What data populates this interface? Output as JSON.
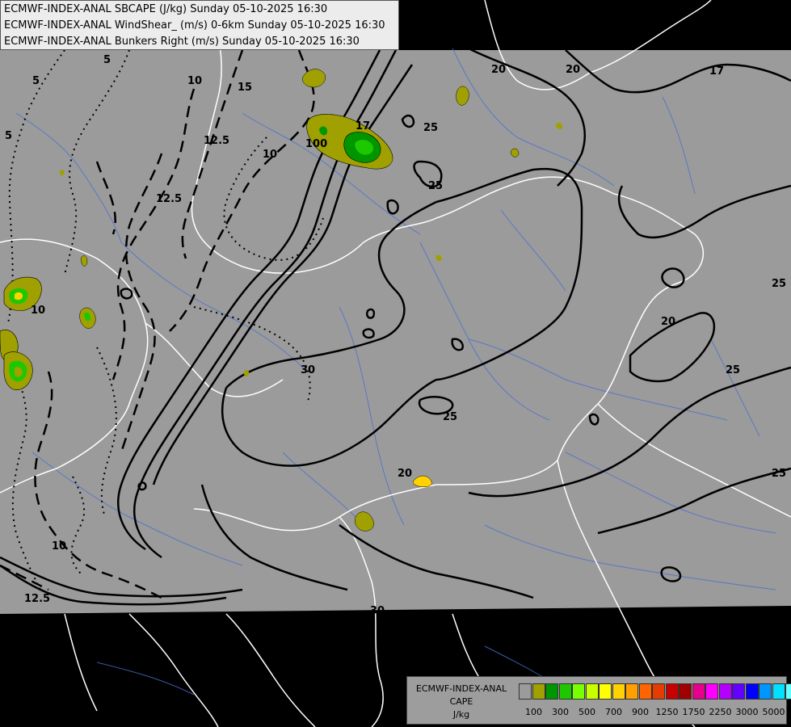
{
  "header": {
    "lines": [
      "ECMWF-INDEX-ANAL SBCAPE (J/kg) Sunday 05-10-2025 16:30",
      "ECMWF-INDEX-ANAL WindShear_ (m/s) 0-6km Sunday 05-10-2025 16:30",
      "ECMWF-INDEX-ANAL Bunkers Right (m/s) Sunday 05-10-2025 16:30"
    ]
  },
  "map": {
    "background_color": "#9b9b9b",
    "outside_color": "#000000",
    "contour_labels": [
      "5",
      "5",
      "5",
      "10",
      "12.5",
      "12.5",
      "15",
      "17",
      "10",
      "100",
      "20",
      "20",
      "17",
      "25",
      "25",
      "30",
      "25",
      "20",
      "25",
      "25",
      "25",
      "20",
      "10",
      "12.5",
      "30",
      "10"
    ],
    "colors": {
      "cape_100": "#a0a000",
      "cape_300": "#009600",
      "cape_500": "#1ec800",
      "cape_700": "#ffd200"
    }
  },
  "legend": {
    "title_lines": [
      "ECMWF-INDEX-ANAL",
      "CAPE",
      "J/kg"
    ],
    "swatches": [
      "#9b9b9b",
      "#a0a000",
      "#009600",
      "#1ec800",
      "#78ff00",
      "#c8ff00",
      "#ffff00",
      "#ffd200",
      "#ffa000",
      "#ff6400",
      "#e63c00",
      "#c80000",
      "#a00000",
      "#e6008c",
      "#ff00ff",
      "#b400ff",
      "#6400ff",
      "#0000ff",
      "#0096ff",
      "#00e1ff",
      "#64ffff",
      "#ffffff"
    ],
    "tick_labels": [
      "100",
      "300",
      "500",
      "700",
      "900",
      "1250",
      "1750",
      "2250",
      "3000",
      "5000"
    ]
  }
}
